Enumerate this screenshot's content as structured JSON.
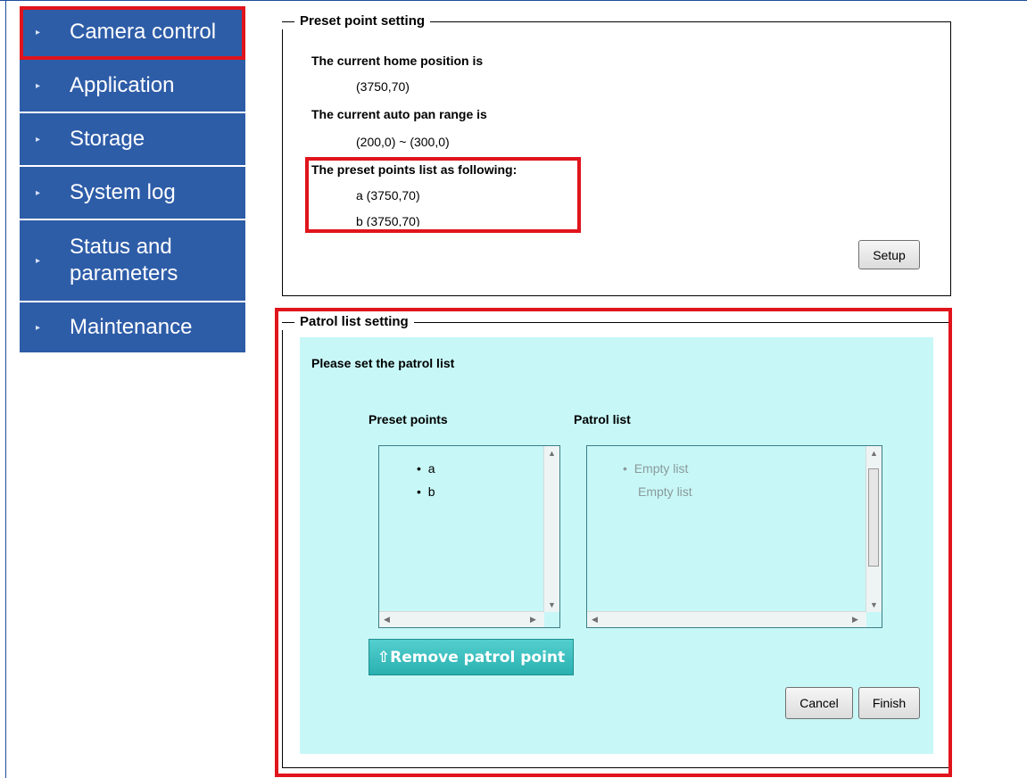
{
  "sidebar": {
    "items": [
      {
        "label": "Camera control",
        "active": true
      },
      {
        "label": "Application"
      },
      {
        "label": "Storage"
      },
      {
        "label": "System log"
      },
      {
        "label": "Status and parameters"
      },
      {
        "label": "Maintenance"
      }
    ],
    "arrow": "▸"
  },
  "preset": {
    "legend": "Preset point setting",
    "home_label": "The current home position is",
    "home_value": "(3750,70)",
    "autopan_label": "The current auto pan range is",
    "autopan_value": "(200,0) ~ (300,0)",
    "list_label": "The preset points list as following:",
    "points": [
      "a (3750,70)",
      "b (3750,70)"
    ],
    "setup_label": "Setup"
  },
  "patrol": {
    "legend": "Patrol list setting",
    "instruction": "Please set the patrol list",
    "preset_header": "Preset points",
    "patrol_header": "Patrol list",
    "preset_items": [
      "a",
      "b"
    ],
    "patrol_items": [
      "Empty list",
      "Empty list"
    ],
    "remove_label": "⇧Remove patrol point",
    "cancel_label": "Cancel",
    "finish_label": "Finish"
  },
  "colors": {
    "sidebar_bg": "#2e5da8",
    "highlight": "#e0141c",
    "panel_bg": "#c8f7f7",
    "button_teal": "#2ab0b0"
  }
}
